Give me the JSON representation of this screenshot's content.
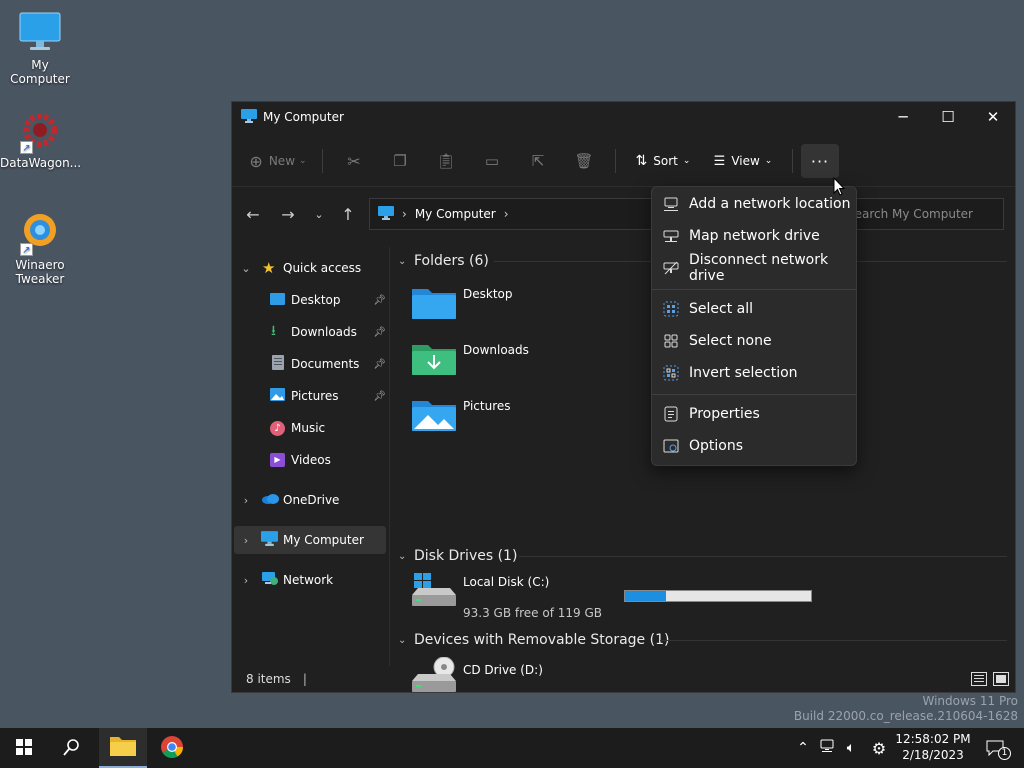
{
  "desktop": {
    "icons": [
      {
        "label": "My Computer"
      },
      {
        "label": "DataWagon..."
      },
      {
        "label": "Winaero Tweaker"
      }
    ]
  },
  "window": {
    "title": "My Computer",
    "controls": {
      "minimize": "─",
      "maximize": "☐",
      "close": "✕"
    }
  },
  "toolbar": {
    "new_label": "New",
    "sort_label": "Sort",
    "view_label": "View",
    "more_label": "···"
  },
  "address": {
    "path": "My Computer",
    "search_placeholder": "Search My Computer"
  },
  "sidebar": {
    "quick_access": "Quick access",
    "items": [
      {
        "label": "Desktop",
        "pinned": true
      },
      {
        "label": "Downloads",
        "pinned": true
      },
      {
        "label": "Documents",
        "pinned": true
      },
      {
        "label": "Pictures",
        "pinned": true
      },
      {
        "label": "Music",
        "pinned": false
      },
      {
        "label": "Videos",
        "pinned": false
      }
    ],
    "onedrive": "OneDrive",
    "my_computer": "My Computer",
    "network": "Network"
  },
  "content": {
    "folders_header": "Folders (6)",
    "folders": [
      {
        "name": "Desktop"
      },
      {
        "name": "Downloads"
      },
      {
        "name": "Pictures"
      }
    ],
    "drives_header": "Disk Drives (1)",
    "drive": {
      "name": "Local Disk (C:)",
      "free": "93.3 GB free of 119 GB",
      "used_fraction": 0.22
    },
    "removable_header": "Devices with Removable Storage (1)",
    "cd_drive": "CD Drive (D:)"
  },
  "menu": {
    "items": [
      "Add a network location",
      "Map network drive",
      "Disconnect network drive",
      "Select all",
      "Select none",
      "Invert selection",
      "Properties",
      "Options"
    ]
  },
  "statusbar": {
    "count": "8 items"
  },
  "watermark": {
    "line1": "Windows 11 Pro",
    "line2": "Build 22000.co_release.210604-1628"
  },
  "taskbar": {
    "time": "12:58:02 PM",
    "date": "2/18/2023",
    "notification_count": "1"
  },
  "colors": {
    "accent": "#1c8fe0",
    "desktop_bg": "#4a5562",
    "window_bg": "#202020"
  }
}
